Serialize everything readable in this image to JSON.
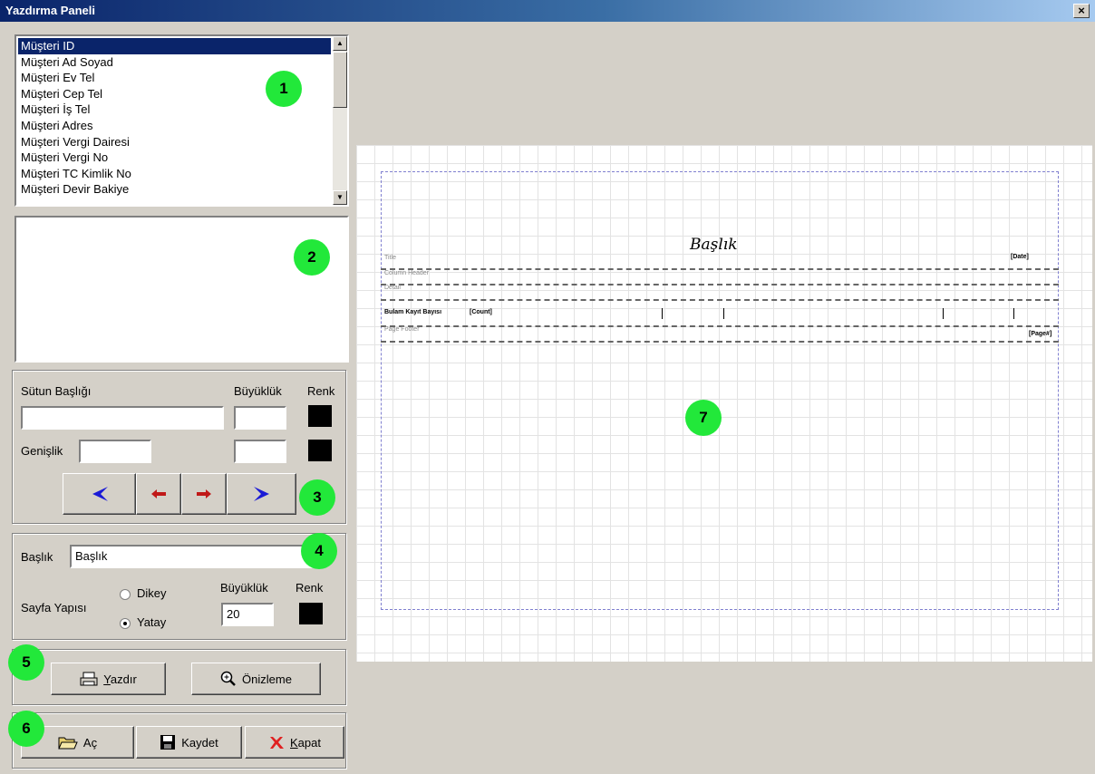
{
  "window": {
    "title": "Yazdırma Paneli",
    "close_label": "×"
  },
  "fields": {
    "items": [
      "Müşteri ID",
      "Müşteri Ad Soyad",
      "Müşteri Ev Tel",
      "Müşteri Cep Tel",
      "Müşteri İş Tel",
      "Müşteri Adres",
      "Müşteri Vergi Dairesi",
      "Müşteri Vergi No",
      "Müşteri TC Kimlik No",
      "Müşteri Devir Bakiye"
    ],
    "selected": "Müşteri ID"
  },
  "column": {
    "header_label": "Sütun Başlığı",
    "size_label": "Büyüklük",
    "color_label": "Renk",
    "width_label": "Genişlik",
    "header_value": "",
    "size_value": "",
    "width_value": "",
    "size2_value": "",
    "color": "#000000"
  },
  "title_group": {
    "title_label": "Başlık",
    "title_value": "Başlık",
    "page_label": "Sayfa Yapısı",
    "size_label": "Büyüklük",
    "color_label": "Renk",
    "portrait": "Dikey",
    "landscape": "Yatay",
    "selected": "Yatay",
    "size_value": "20",
    "color": "#000000"
  },
  "print": {
    "print_key": "Y",
    "print_rest": "azdır",
    "preview_label": "Önizleme"
  },
  "file": {
    "open_label": "Aç",
    "save_label": "Kaydet",
    "close_key": "K",
    "close_rest": "apat"
  },
  "badges": [
    "1",
    "2",
    "3",
    "4",
    "5",
    "6",
    "7"
  ],
  "preview": {
    "heading": "Başlık",
    "title_band": "Title",
    "header_band": "Column Header",
    "detail_band": "Detail",
    "footer_band": "Page Footer",
    "group_text": "Bulam Kayıt Bayısı",
    "count_text": "[Count]",
    "date_text": "[Date]",
    "page_text": "[Page#]"
  },
  "colors": {
    "badge": "#22e83a",
    "selection": "#0a246a",
    "arrow_nav": "#1a1ad6",
    "arrow_move": "#c01818"
  }
}
